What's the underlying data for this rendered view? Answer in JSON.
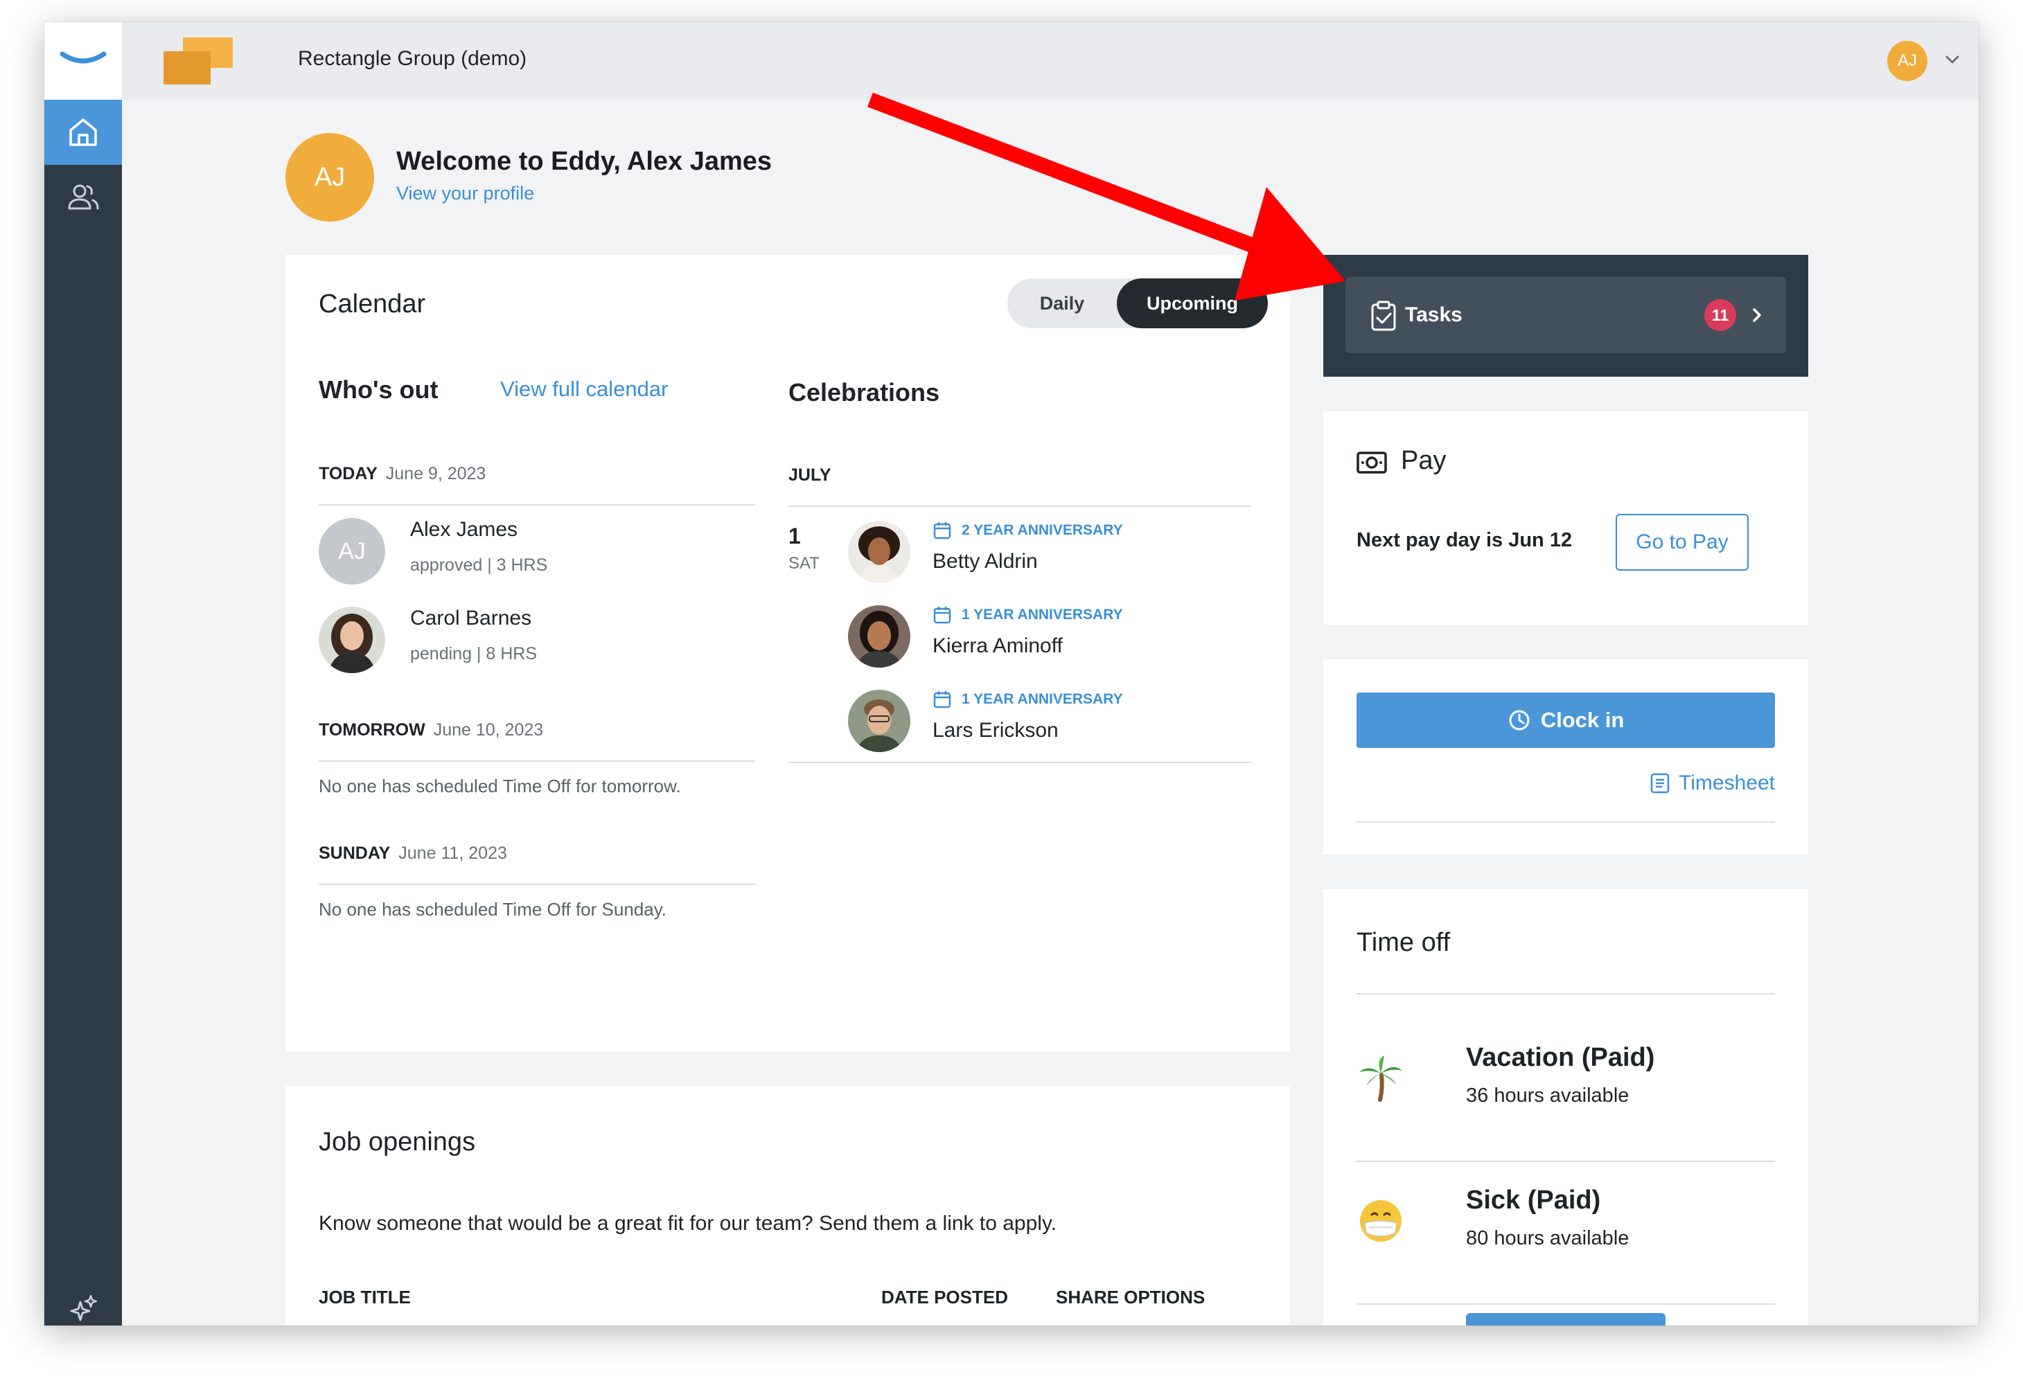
{
  "company": {
    "name": "Rectangle Group (demo)"
  },
  "user": {
    "initials": "AJ"
  },
  "welcome": {
    "title": "Welcome to Eddy, Alex James",
    "link": "View your profile"
  },
  "calendar": {
    "title": "Calendar",
    "toggle": {
      "daily": "Daily",
      "upcoming": "Upcoming",
      "selected": "Upcoming"
    },
    "whos_out": {
      "heading": "Who's out",
      "link": "View full calendar",
      "days": [
        {
          "label": "TODAY",
          "date": "June 9, 2023",
          "people": [
            {
              "initials": "AJ",
              "name": "Alex James",
              "status": "approved | 3 HRS"
            },
            {
              "name": "Carol Barnes",
              "status": "pending | 8 HRS"
            }
          ]
        },
        {
          "label": "TOMORROW",
          "date": "June 10, 2023",
          "empty": "No one has scheduled Time Off for tomorrow."
        },
        {
          "label": "SUNDAY",
          "date": "June 11, 2023",
          "empty": "No one has scheduled Time Off for Sunday."
        }
      ]
    },
    "celebrations": {
      "heading": "Celebrations",
      "month": "JULY",
      "day_num": "1",
      "day_dow": "SAT",
      "items": [
        {
          "type": "2 YEAR ANNIVERSARY",
          "name": "Betty Aldrin"
        },
        {
          "type": "1 YEAR ANNIVERSARY",
          "name": "Kierra Aminoff"
        },
        {
          "type": "1 YEAR ANNIVERSARY",
          "name": "Lars Erickson"
        }
      ]
    }
  },
  "jobs": {
    "title": "Job openings",
    "description": "Know someone that would be a great fit for our team? Send them a link to apply.",
    "columns": [
      "JOB TITLE",
      "DATE POSTED",
      "SHARE OPTIONS"
    ]
  },
  "tasks": {
    "label": "Tasks",
    "count": "11"
  },
  "pay": {
    "title": "Pay",
    "next": "Next pay day is Jun 12",
    "button": "Go to Pay"
  },
  "clock": {
    "button": "Clock in",
    "timesheet": "Timesheet"
  },
  "time_off": {
    "title": "Time off",
    "items": [
      {
        "name": "Vacation (Paid)",
        "hours": "36 hours available",
        "icon": "palm-tree-icon"
      },
      {
        "name": "Sick (Paid)",
        "hours": "80 hours available",
        "icon": "face-with-mask-icon"
      }
    ]
  },
  "colors": {
    "accent": "#4a96d9",
    "sidebar": "#2f3a47",
    "badge": "#d93b5a",
    "avatar": "#f0ad3c",
    "annotation_arrow": "#ff0000"
  }
}
